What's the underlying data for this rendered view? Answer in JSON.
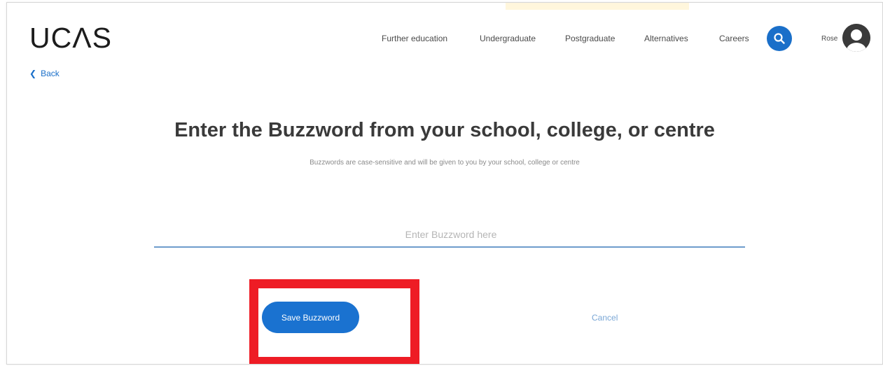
{
  "header": {
    "logo": "UCΛS",
    "nav": [
      {
        "label": "Further education"
      },
      {
        "label": "Undergraduate"
      },
      {
        "label": "Postgraduate"
      },
      {
        "label": "Alternatives"
      },
      {
        "label": "Careers"
      }
    ],
    "search_icon": "search-icon",
    "user_name": "Rose",
    "avatar_icon": "user-avatar-icon"
  },
  "back": {
    "label": "Back",
    "icon": "chevron-left-icon"
  },
  "main": {
    "title": "Enter the Buzzword from your school, college, or centre",
    "subtitle": "Buzzwords are case-sensitive and will be given to you by your school, college or centre",
    "input": {
      "placeholder": "Enter Buzzword here",
      "value": ""
    },
    "save_label": "Save Buzzword",
    "cancel_label": "Cancel"
  },
  "colors": {
    "accent": "#1a72d0",
    "highlight": "#ee1c25"
  }
}
